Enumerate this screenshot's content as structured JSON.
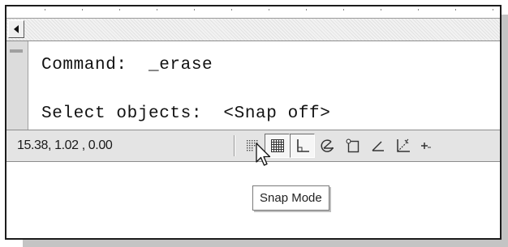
{
  "command_window": {
    "line1": "Command:  _erase",
    "line2": "Select objects:  <Snap off>"
  },
  "status_bar": {
    "coordinates": "15.38, 1.02 , 0.00",
    "buttons": [
      {
        "name": "snap-mode",
        "icon": "snap-grid-dots-icon",
        "pressed": false
      },
      {
        "name": "grid-display",
        "icon": "grid-icon",
        "pressed": true
      },
      {
        "name": "ortho-mode",
        "icon": "ortho-icon",
        "pressed": true
      },
      {
        "name": "polar-tracking",
        "icon": "polar-icon",
        "pressed": false
      },
      {
        "name": "object-snap",
        "icon": "osnap-icon",
        "pressed": false
      },
      {
        "name": "object-snap-tracking",
        "icon": "otrack-icon",
        "pressed": false
      },
      {
        "name": "dynamic-ucs",
        "icon": "ducs-icon",
        "pressed": false
      },
      {
        "name": "dynamic-input",
        "icon": "dyn-icon",
        "pressed": false
      }
    ]
  },
  "tooltip": {
    "text": "Snap Mode"
  },
  "icons": {
    "scroll_left": "triangle-left-icon",
    "pointer": "arrow-cursor-icon"
  },
  "colors": {
    "status_bar_bg": "#e4e4e4",
    "pressed_button_bg": "#f6f6f6",
    "shadow": "#c4c4c4"
  }
}
